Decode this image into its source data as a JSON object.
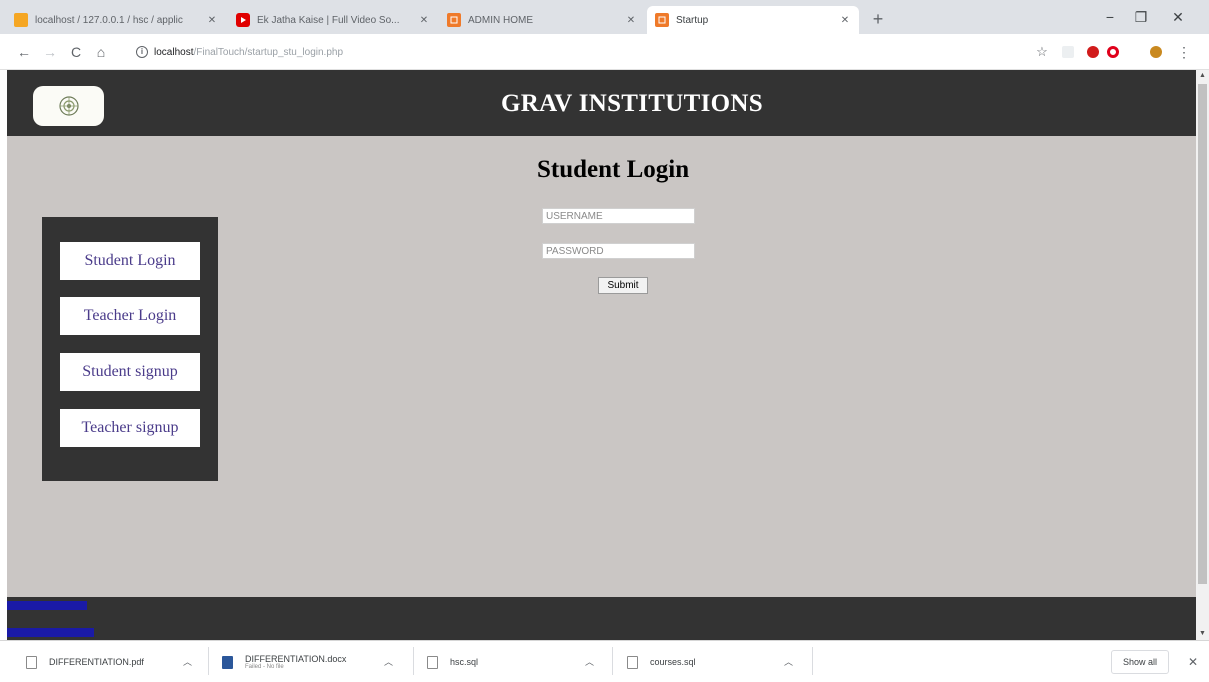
{
  "browser": {
    "tabs": [
      {
        "title": "localhost / 127.0.0.1 / hsc / applic",
        "favicon_color": "#f5a623",
        "close": "✕"
      },
      {
        "title": "Ek Jatha Kaise | Full Video So...",
        "favicon_color": "#e00000",
        "close": "✕"
      },
      {
        "title": "ADMIN HOME",
        "favicon_color": "#ef7a2a",
        "close": "✕"
      },
      {
        "title": "Startup",
        "favicon_color": "#ef7a2a",
        "close": "✕"
      }
    ],
    "new_tab": "+",
    "window_controls": {
      "minimize": "−",
      "maximize": "❐",
      "close": "✕"
    },
    "toolbar": {
      "back": "←",
      "forward": "→",
      "reload": "C",
      "home": "⌂",
      "bookmark_star": "☆",
      "menu": "⋮"
    },
    "address": {
      "host": "localhost",
      "path": "/FinalTouch/startup_stu_login.php"
    }
  },
  "site": {
    "title": "GRAV INSTITUTIONS",
    "logo_icon": "emblem-icon",
    "sidebar": [
      {
        "label": "Student Login"
      },
      {
        "label": "Teacher Login"
      },
      {
        "label": "Student signup"
      },
      {
        "label": "Teacher signup"
      }
    ],
    "login": {
      "heading": "Student Login",
      "username_placeholder": "USERNAME",
      "password_placeholder": "PASSWORD",
      "submit": "Submit"
    }
  },
  "downloads": {
    "items": [
      {
        "name": "DIFFERENTIATION.pdf",
        "sub": ""
      },
      {
        "name": "DIFFERENTIATION.docx",
        "sub": "Failed - No file"
      },
      {
        "name": "hsc.sql",
        "sub": ""
      },
      {
        "name": "courses.sql",
        "sub": ""
      }
    ],
    "show_all": "Show all",
    "close": "✕"
  },
  "colors": {
    "header_bg": "#333333",
    "page_bg": "#cac6c4",
    "sidebar_text": "#4a3b8a"
  }
}
